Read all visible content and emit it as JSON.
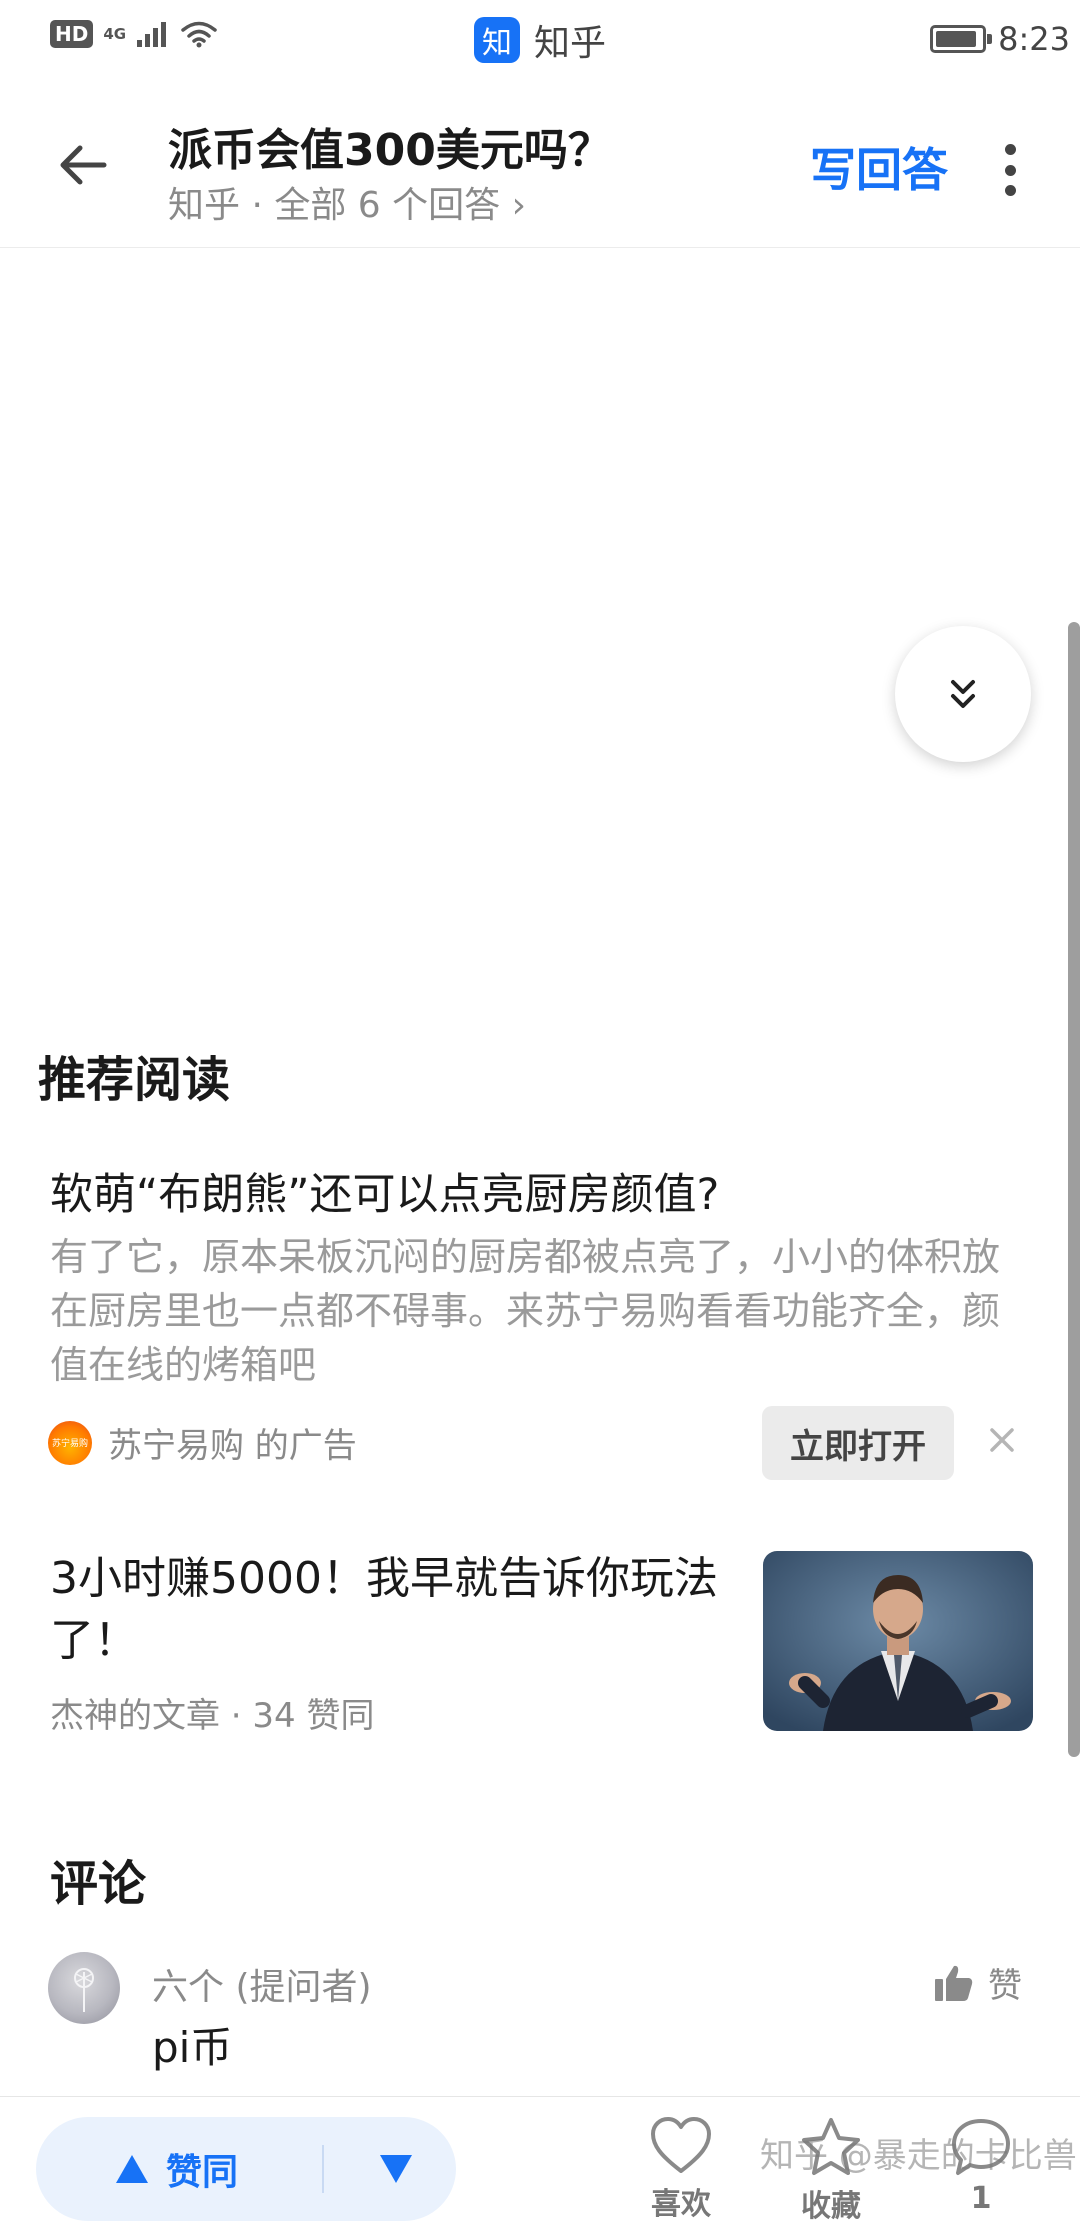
{
  "status_bar": {
    "hd": "HD",
    "network": "4G",
    "app_name": "知乎",
    "app_logo_char": "知",
    "time": "8:23",
    "battery_level": 0.9
  },
  "header": {
    "title": "派币会值300美元吗？",
    "subtitle": "知乎 · 全部 6 个回答 ›",
    "write_answer": "写回答"
  },
  "recommend": {
    "heading": "推荐阅读",
    "ad": {
      "title": "软萌“布朗熊”还可以点亮厨房颜值?",
      "body": "有了它，原本呆板沉闷的厨房都被点亮了，小小的体积放在厨房里也一点都不碍事。来苏宁易购看看功能齐全，颜值在线的烤箱吧",
      "logo_text": "苏宁易购",
      "source": "苏宁易购 的广告",
      "open_label": "立即打开"
    },
    "article": {
      "title": "3小时赚5000！我早就告诉你玩法了！",
      "meta": "杰神的文章 · 34 赞同"
    }
  },
  "comments": {
    "heading": "评论",
    "items": [
      {
        "author": "六个 (提问者)",
        "text": "pi币",
        "like_label": "赞"
      }
    ]
  },
  "bottom_bar": {
    "upvote_label": "赞同",
    "like_label": "喜欢",
    "favorite_label": "收藏",
    "comment_label": "1"
  },
  "watermark": "知乎 @暴走的卡比兽",
  "colors": {
    "accent": "#1772f6",
    "muted_text": "#8a8a8a",
    "vote_bg": "#eaf2fd"
  }
}
